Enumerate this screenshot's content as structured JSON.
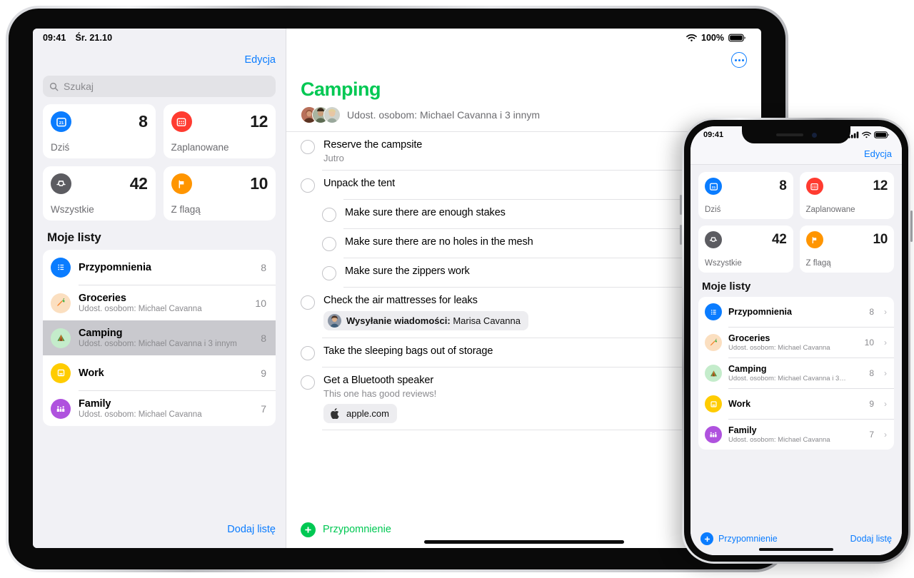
{
  "ipad": {
    "status": {
      "time": "09:41",
      "date": "Śr. 21.10",
      "battery_pct": "100%",
      "wifi_icon": "wifi-icon",
      "battery_icon": "battery-icon"
    },
    "sidebar": {
      "edit_label": "Edycja",
      "search": {
        "placeholder": "Szukaj",
        "icon": "search-icon"
      },
      "smart_cards": [
        {
          "label": "Dziś",
          "count": "8",
          "icon": "calendar-day-icon",
          "icon_glyph": "21",
          "color": "#0a7cff"
        },
        {
          "label": "Zaplanowane",
          "count": "12",
          "icon": "calendar-icon",
          "icon_glyph": "▦",
          "color": "#ff3b30"
        },
        {
          "label": "Wszystkie",
          "count": "42",
          "icon": "inbox-tray-icon",
          "icon_glyph": "▽",
          "color": "#5c5c61"
        },
        {
          "label": "Z flagą",
          "count": "10",
          "icon": "flag-icon",
          "icon_glyph": "⚑",
          "color": "#ff9500"
        }
      ],
      "section_title": "Moje listy",
      "lists": [
        {
          "title": "Przypomnienia",
          "subtitle": "",
          "count": "8",
          "icon": "list-bullet-icon",
          "icon_glyph": "☰",
          "color": "#0a7cff",
          "selected": false
        },
        {
          "title": "Groceries",
          "subtitle": "Udost. osobom: Michael Cavanna",
          "count": "10",
          "icon": "carrot-icon",
          "icon_glyph": "🥕",
          "color": "#fbdfc0",
          "selected": false
        },
        {
          "title": "Camping",
          "subtitle": "Udost. osobom: Michael Cavanna i 3 innym",
          "count": "8",
          "icon": "tent-icon",
          "icon_glyph": "⛺",
          "color": "#c4eccb",
          "selected": true
        },
        {
          "title": "Work",
          "subtitle": "",
          "count": "9",
          "icon": "book-icon",
          "icon_glyph": "▤",
          "color": "#ffcc00",
          "selected": false
        },
        {
          "title": "Family",
          "subtitle": "Udost. osobom: Michael Cavanna",
          "count": "7",
          "icon": "family-icon",
          "icon_glyph": "👪",
          "color": "#af52de",
          "selected": false
        }
      ],
      "add_list_label": "Dodaj listę"
    },
    "detail": {
      "more_button": "more-options-icon",
      "title": "Camping",
      "title_color": "#00c853",
      "shared_text": "Udost. osobom: Michael Cavanna i 3 innym",
      "reminders": [
        {
          "title": "Reserve the campsite",
          "note": "Jutro",
          "sub": false,
          "chip": null
        },
        {
          "title": "Unpack the tent",
          "note": "",
          "sub": false,
          "chip": null
        },
        {
          "title": "Make sure there are enough stakes",
          "note": "",
          "sub": true,
          "chip": null
        },
        {
          "title": "Make sure there are no holes in the mesh",
          "note": "",
          "sub": true,
          "chip": null
        },
        {
          "title": "Make sure the zippers work",
          "note": "",
          "sub": true,
          "chip": null
        },
        {
          "title": "Check the air mattresses for leaks",
          "note": "",
          "sub": false,
          "chip": {
            "bold": "Wysyłanie wiadomości:",
            "rest": " Marisa Cavanna",
            "icon": "avatar-icon"
          }
        },
        {
          "title": "Take the sleeping bags out of storage",
          "note": "",
          "sub": false,
          "chip": null
        },
        {
          "title": "Get a Bluetooth speaker",
          "note": "This one has good reviews!",
          "sub": false,
          "chip": {
            "bold": "",
            "rest": "apple.com",
            "icon": "apple-logo-icon"
          }
        }
      ],
      "add_reminder_label": "Przypomnienie"
    }
  },
  "iphone": {
    "status": {
      "time": "09:41",
      "cellular_icon": "cellular-icon",
      "wifi_icon": "wifi-icon",
      "battery_icon": "battery-icon"
    },
    "edit_label": "Edycja",
    "smart_cards": [
      {
        "label": "Dziś",
        "count": "8",
        "icon": "calendar-day-icon",
        "icon_glyph": "21",
        "color": "#0a7cff"
      },
      {
        "label": "Zaplanowane",
        "count": "12",
        "icon": "calendar-icon",
        "icon_glyph": "▦",
        "color": "#ff3b30"
      },
      {
        "label": "Wszystkie",
        "count": "42",
        "icon": "inbox-tray-icon",
        "icon_glyph": "▽",
        "color": "#5c5c61"
      },
      {
        "label": "Z flagą",
        "count": "10",
        "icon": "flag-icon",
        "icon_glyph": "⚑",
        "color": "#ff9500"
      }
    ],
    "section_title": "Moje listy",
    "lists": [
      {
        "title": "Przypomnienia",
        "subtitle": "",
        "count": "8",
        "icon": "list-bullet-icon",
        "icon_glyph": "☰",
        "color": "#0a7cff"
      },
      {
        "title": "Groceries",
        "subtitle": "Udost. osobom: Michael Cavanna",
        "count": "10",
        "icon": "carrot-icon",
        "icon_glyph": "🥕",
        "color": "#fbdfc0"
      },
      {
        "title": "Camping",
        "subtitle": "Udost. osobom: Michael Cavanna i 3…",
        "count": "8",
        "icon": "tent-icon",
        "icon_glyph": "⛺",
        "color": "#c4eccb"
      },
      {
        "title": "Work",
        "subtitle": "",
        "count": "9",
        "icon": "book-icon",
        "icon_glyph": "▤",
        "color": "#ffcc00"
      },
      {
        "title": "Family",
        "subtitle": "Udost. osobom: Michael Cavanna",
        "count": "7",
        "icon": "family-icon",
        "icon_glyph": "👪",
        "color": "#af52de"
      }
    ],
    "add_reminder_label": "Przypomnienie",
    "add_list_label": "Dodaj listę",
    "chevron": "›"
  }
}
